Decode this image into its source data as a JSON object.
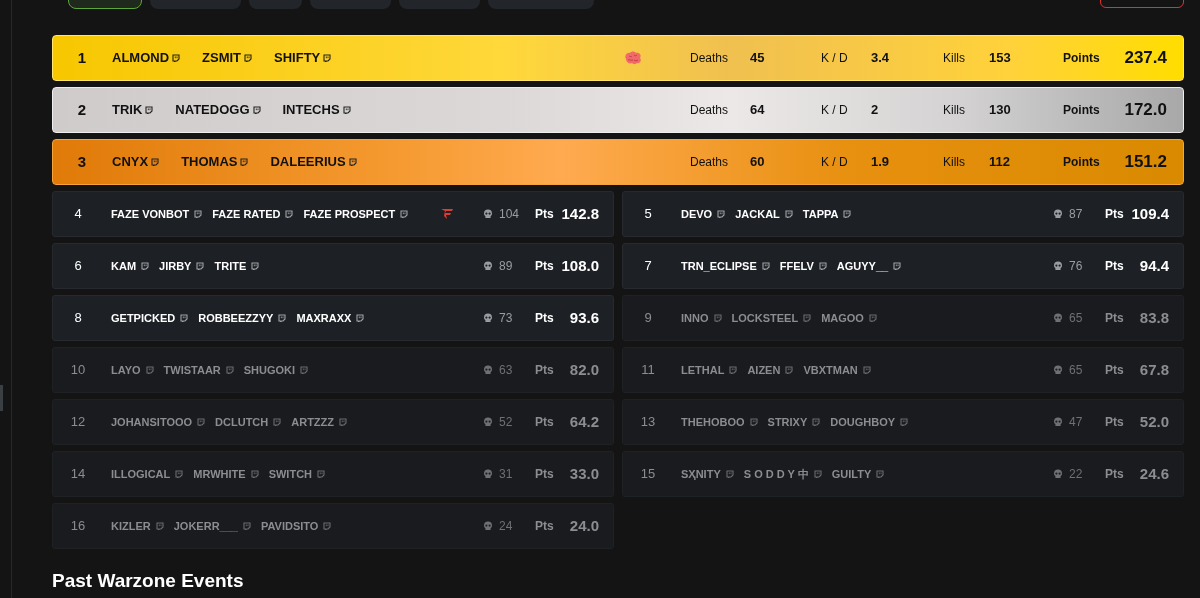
{
  "tabs": [
    {
      "selected": true
    },
    {
      "selected": false
    },
    {
      "selected": false
    },
    {
      "selected": false
    },
    {
      "selected": false
    },
    {
      "selected": false
    }
  ],
  "podium": [
    {
      "rank": "1",
      "kind": "gold",
      "players": [
        "ALMOND",
        "ZSMIT",
        "SHIFTY"
      ],
      "badge": {
        "kind": "brain"
      },
      "deaths_label": "Deaths",
      "deaths": "45",
      "kd_label": "K / D",
      "kd": "3.4",
      "kills_label": "Kills",
      "kills": "153",
      "points_label": "Points",
      "points": "237.4"
    },
    {
      "rank": "2",
      "kind": "silver",
      "players": [
        "TRIK",
        "NATEDOGG",
        "INTECHS"
      ],
      "deaths_label": "Deaths",
      "deaths": "64",
      "kd_label": "K / D",
      "kd": "2",
      "kills_label": "Kills",
      "kills": "130",
      "points_label": "Points",
      "points": "172.0"
    },
    {
      "rank": "3",
      "kind": "bronze",
      "players": [
        "CNYX",
        "THOMAS",
        "DALEERIUS"
      ],
      "deaths_label": "Deaths",
      "deaths": "60",
      "kd_label": "K / D",
      "kd": "1.9",
      "kills_label": "Kills",
      "kills": "112",
      "points_label": "Points",
      "points": "151.2"
    }
  ],
  "teams": [
    {
      "rank": "4",
      "players": [
        "FAZE VONBOT",
        "FAZE RATED",
        "FAZE PROSPECT"
      ],
      "badge": {
        "kind": "team-logo"
      },
      "deaths": "104",
      "points_label": "Pts",
      "points": "142.8",
      "dimmed": false
    },
    {
      "rank": "5",
      "players": [
        "DEVO",
        "JACKAL",
        "TAPPA"
      ],
      "deaths": "87",
      "points_label": "Pts",
      "points": "109.4",
      "dimmed": false
    },
    {
      "rank": "6",
      "players": [
        "KAM",
        "JIRBY",
        "TRITE"
      ],
      "deaths": "89",
      "points_label": "Pts",
      "points": "108.0",
      "dimmed": false
    },
    {
      "rank": "7",
      "players": [
        "TRN_ECLIPSE",
        "FFELV",
        "AGUYY__"
      ],
      "deaths": "76",
      "points_label": "Pts",
      "points": "94.4",
      "dimmed": false
    },
    {
      "rank": "8",
      "players": [
        "GETPICKED",
        "ROBBEEZZYY",
        "MAXRAXX"
      ],
      "deaths": "73",
      "points_label": "Pts",
      "points": "93.6",
      "dimmed": false
    },
    {
      "rank": "9",
      "players": [
        "INNO",
        "LOCKSTEEL",
        "MAGOO"
      ],
      "deaths": "65",
      "points_label": "Pts",
      "points": "83.8",
      "dimmed": true
    },
    {
      "rank": "10",
      "players": [
        "LAYO",
        "TWISTAAR",
        "SHUGOKI"
      ],
      "deaths": "63",
      "points_label": "Pts",
      "points": "82.0",
      "dimmed": true
    },
    {
      "rank": "11",
      "players": [
        "LETHAL",
        "AIZEN",
        "VBXTMAN"
      ],
      "deaths": "65",
      "points_label": "Pts",
      "points": "67.8",
      "dimmed": true
    },
    {
      "rank": "12",
      "players": [
        "JOHANSITOOO",
        "DCLUTCH",
        "ARTZZZ"
      ],
      "deaths": "52",
      "points_label": "Pts",
      "points": "64.2",
      "dimmed": true
    },
    {
      "rank": "13",
      "players": [
        "THEHOBOO",
        "STRIXY",
        "DOUGHBOY"
      ],
      "deaths": "47",
      "points_label": "Pts",
      "points": "52.0",
      "dimmed": true
    },
    {
      "rank": "14",
      "players": [
        "ILLOGICAL",
        "MRWHITE",
        "SWITCH"
      ],
      "deaths": "31",
      "points_label": "Pts",
      "points": "33.0",
      "dimmed": true
    },
    {
      "rank": "15",
      "players": [
        "SҲNITY",
        "S O D D Y 中",
        "GUILTY"
      ],
      "deaths": "22",
      "points_label": "Pts",
      "points": "24.6",
      "dimmed": true
    },
    {
      "rank": "16",
      "players": [
        "KIZLER",
        "JOKERR___",
        "PAVIDSITO"
      ],
      "deaths": "24",
      "points_label": "Pts",
      "points": "24.0",
      "dimmed": true
    }
  ],
  "section_title": "Past Warzone Events"
}
